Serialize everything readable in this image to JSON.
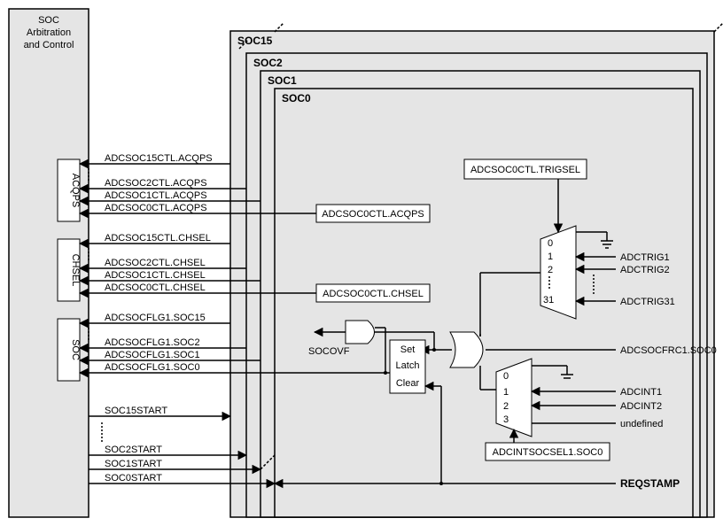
{
  "left_block": {
    "title_line1": "SOC",
    "title_line2": "Arbitration",
    "title_line3": "and Control",
    "sub_blocks": [
      "ACQPS",
      "CHSEL",
      "SOC"
    ]
  },
  "soc_panels": [
    "SOC15",
    "SOC2",
    "SOC1",
    "SOC0"
  ],
  "signals": {
    "acqps": [
      "ADCSOC15CTL.ACQPS",
      "ADCSOC2CTL.ACQPS",
      "ADCSOC1CTL.ACQPS",
      "ADCSOC0CTL.ACQPS"
    ],
    "chsel": [
      "ADCSOC15CTL.CHSEL",
      "ADCSOC2CTL.CHSEL",
      "ADCSOC1CTL.CHSEL",
      "ADCSOC0CTL.CHSEL"
    ],
    "soc_flags": [
      "ADCSOCFLG1.SOC15",
      "ADCSOCFLG1.SOC2",
      "ADCSOCFLG1.SOC1",
      "ADCSOCFLG1.SOC0"
    ],
    "starts": [
      "SOC15START",
      "SOC2START",
      "SOC1START",
      "SOC0START"
    ]
  },
  "soc0": {
    "trigsel_label": "ADCSOC0CTL.TRIGSEL",
    "acqps_label": "ADCSOC0CTL.ACQPS",
    "chsel_label": "ADCSOC0CTL.CHSEL",
    "socovf": "SOCOVF",
    "latch": {
      "set": "Set",
      "mid": "Latch",
      "clear": "Clear"
    },
    "mux_top_inputs": [
      "ADCTRIG1",
      "ADCTRIG2",
      "ADCTRIG31"
    ],
    "mux_top_idx": [
      "0",
      "1",
      "2",
      "31"
    ],
    "adcsocfrc": "ADCSOCFRC1.SOC0",
    "mux_bot_inputs": [
      "ADCINT1",
      "ADCINT2",
      "undefined"
    ],
    "mux_bot_idx": [
      "0",
      "1",
      "2",
      "3"
    ],
    "mux_bot_sel": "ADCINTSOCSEL1.SOC0",
    "reqstamp": "REQSTAMP"
  }
}
